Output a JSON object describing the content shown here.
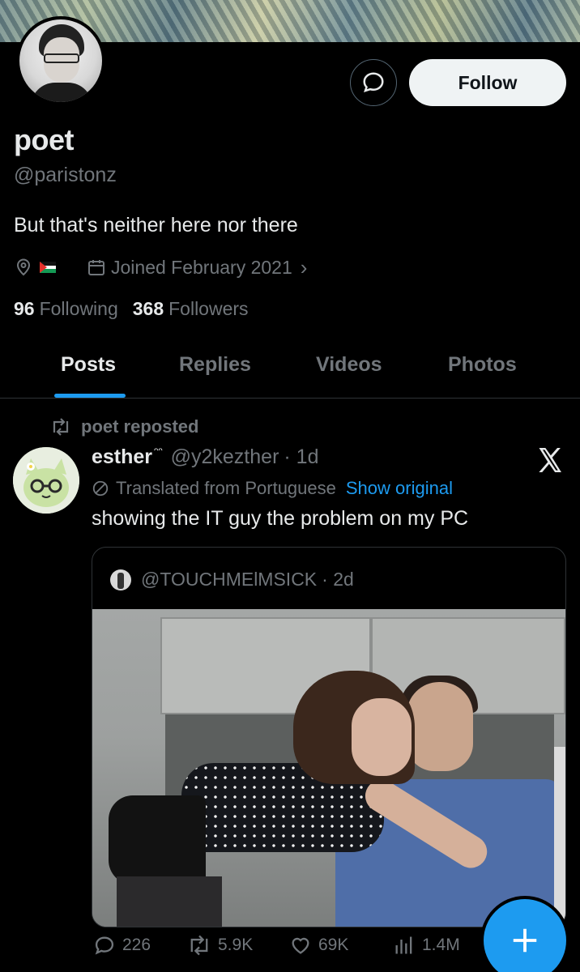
{
  "profile": {
    "name": "poet",
    "handle": "@paristonz",
    "bio": "But that's neither here nor there",
    "joined": "Joined February 2021",
    "joined_chevron": "›",
    "following_count": "96",
    "following_label": "Following",
    "followers_count": "368",
    "followers_label": "Followers",
    "follow_label": "Follow"
  },
  "tabs": [
    {
      "label": "Posts",
      "active": true
    },
    {
      "label": "Replies",
      "active": false
    },
    {
      "label": "Videos",
      "active": false
    },
    {
      "label": "Photos",
      "active": false
    }
  ],
  "post": {
    "repost_label": "poet reposted",
    "author_name": "esther",
    "author_suffix": "ᵔᵔ",
    "author_handle": "@y2kezther",
    "time": "· 1d",
    "translated_label": "Translated from Portuguese",
    "show_original": "Show original",
    "text": "showing the IT guy the problem on my PC",
    "quote": {
      "handle": "@TOUCHMElMSICK",
      "time": "· 2d"
    },
    "stats": {
      "replies": "226",
      "reposts": "5.9K",
      "likes": "69K",
      "views": "1.4M"
    }
  },
  "colors": {
    "accent": "#1d9bf0",
    "text": "#e7e9ea",
    "muted": "#71767b",
    "background": "#000000"
  },
  "icons": [
    "message-icon",
    "location-icon",
    "calendar-icon",
    "repost-icon",
    "x-logo-icon",
    "translate-icon",
    "reply-icon",
    "like-icon",
    "views-icon",
    "plus-icon"
  ]
}
